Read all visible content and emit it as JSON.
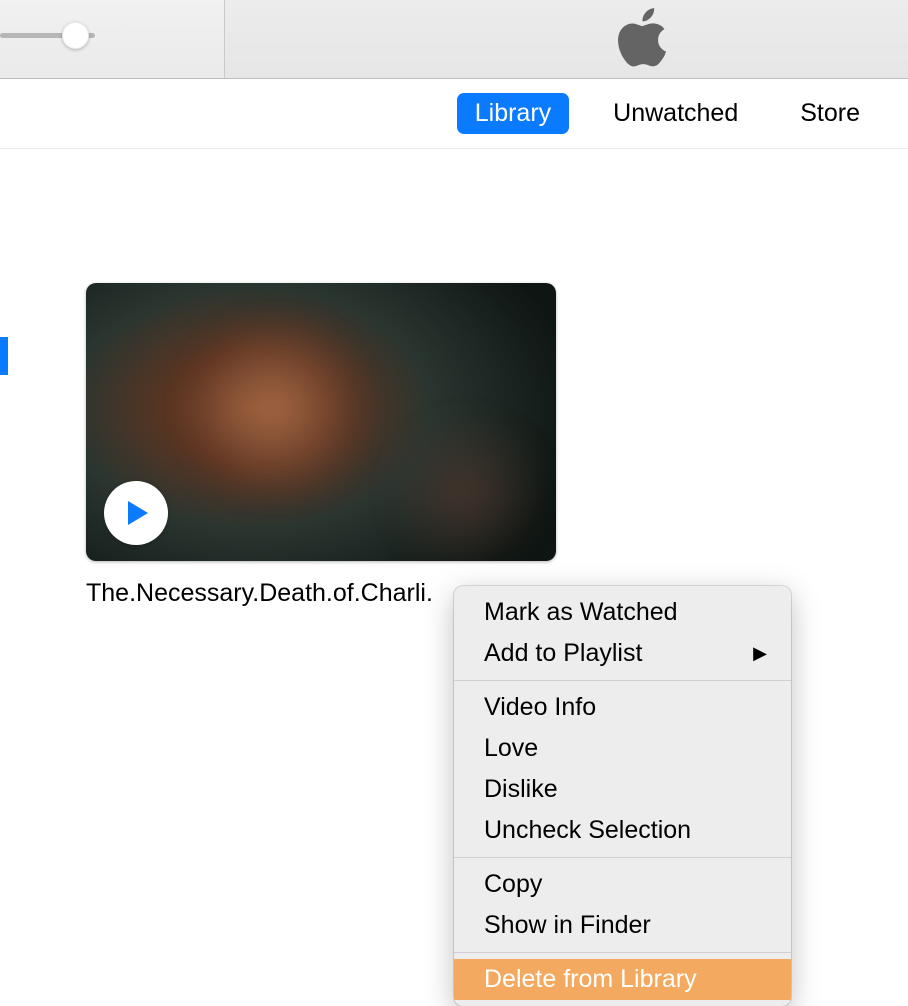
{
  "tabs": {
    "library": "Library",
    "unwatched": "Unwatched",
    "store": "Store"
  },
  "video": {
    "title": "The.Necessary.Death.of.Charli."
  },
  "menu": {
    "mark_watched": "Mark as Watched",
    "add_to_playlist": "Add to Playlist",
    "video_info": "Video Info",
    "love": "Love",
    "dislike": "Dislike",
    "uncheck_selection": "Uncheck Selection",
    "copy": "Copy",
    "show_in_finder": "Show in Finder",
    "delete_from_library": "Delete from Library"
  },
  "icons": {
    "apple": "apple-logo",
    "play": "play-icon",
    "submenu_arrow": "▶"
  }
}
